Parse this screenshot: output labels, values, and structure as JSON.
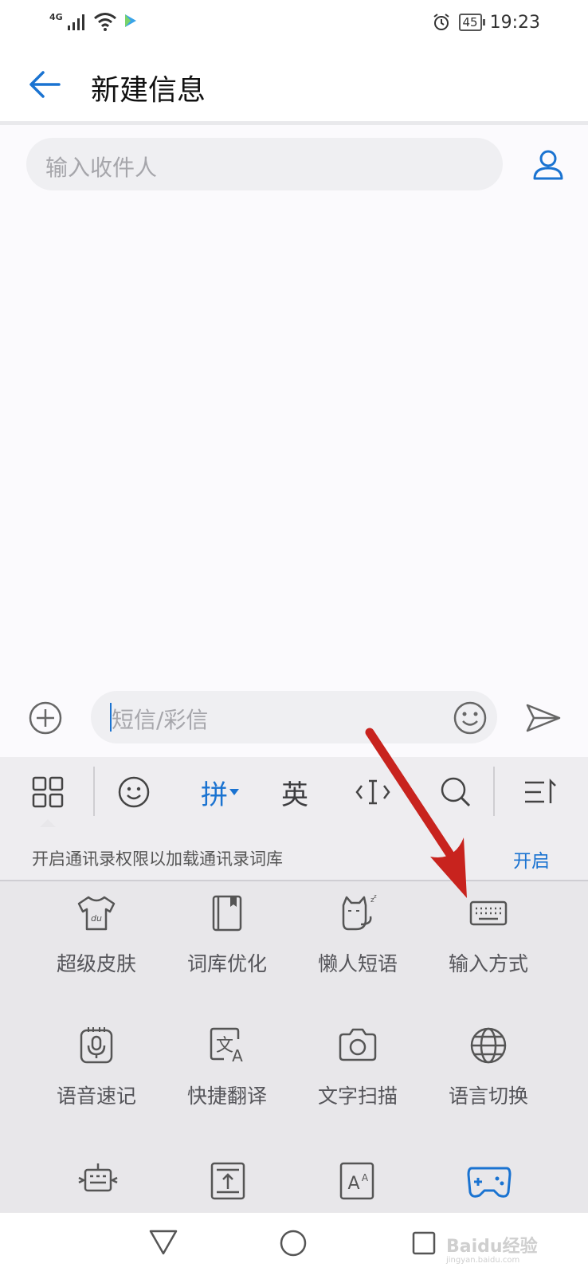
{
  "status_bar": {
    "network": "4G",
    "battery": "45",
    "time": "19:23"
  },
  "header": {
    "title": "新建信息"
  },
  "recipient": {
    "placeholder": "输入收件人"
  },
  "compose": {
    "placeholder": "短信/彩信"
  },
  "keyboard": {
    "toolbar": {
      "pinyin": "拼",
      "english": "英"
    },
    "notice": {
      "text": "开启通讯录权限以加载通讯录词库",
      "action": "开启"
    },
    "tiles": [
      {
        "label": "超级皮肤",
        "icon": "tshirt-icon"
      },
      {
        "label": "词库优化",
        "icon": "book-icon"
      },
      {
        "label": "懒人短语",
        "icon": "cat-icon"
      },
      {
        "label": "输入方式",
        "icon": "keyboard-icon"
      },
      {
        "label": "语音速记",
        "icon": "voice-memo-icon"
      },
      {
        "label": "快捷翻译",
        "icon": "translate-icon"
      },
      {
        "label": "文字扫描",
        "icon": "camera-icon"
      },
      {
        "label": "语言切换",
        "icon": "globe-icon"
      }
    ]
  },
  "watermark": {
    "text": "Baidu经验",
    "sub": "jingyan.baidu.com"
  },
  "colors": {
    "accent": "#1a73d1",
    "annotation_arrow": "#c8231e"
  }
}
